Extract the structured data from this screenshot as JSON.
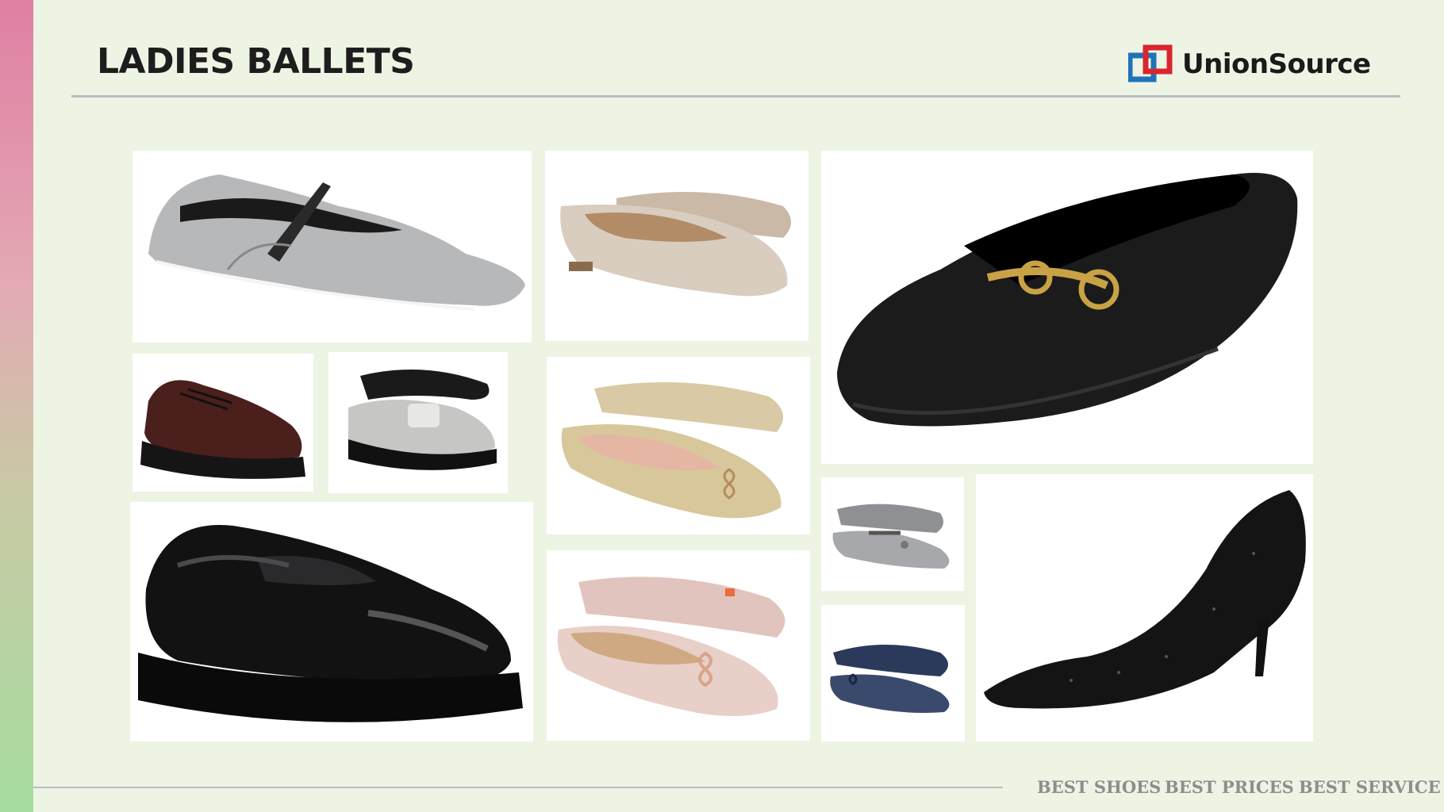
{
  "page": {
    "title": "LADIES BALLETS",
    "brand": {
      "name": "UnionSource",
      "icon": "unionsource-logo-icon"
    },
    "footer": {
      "taglines": [
        "BEST SHOES",
        "BEST PRICES",
        "BEST SERVICE"
      ]
    },
    "colors": {
      "background": "#eef4e3",
      "accent_top": "#e07fa3",
      "accent_bottom": "#a6dca1",
      "logo_red": "#d8262f",
      "logo_blue": "#1f73b7"
    },
    "products": [
      {
        "name": "silver-mary-jane-flat"
      },
      {
        "name": "woven-champagne-square-toe-flat"
      },
      {
        "name": "black-horsebit-loafer"
      },
      {
        "name": "brown-platform-oxford"
      },
      {
        "name": "silver-platform-penny-loafer"
      },
      {
        "name": "gold-textured-bow-ballet-flat"
      },
      {
        "name": "black-patent-chunky-loafer"
      },
      {
        "name": "pink-tweed-bow-ballet-flat"
      },
      {
        "name": "metallic-silver-mary-jane-flat"
      },
      {
        "name": "navy-bow-ballet-flat"
      },
      {
        "name": "black-embellished-stiletto-pump"
      }
    ]
  }
}
